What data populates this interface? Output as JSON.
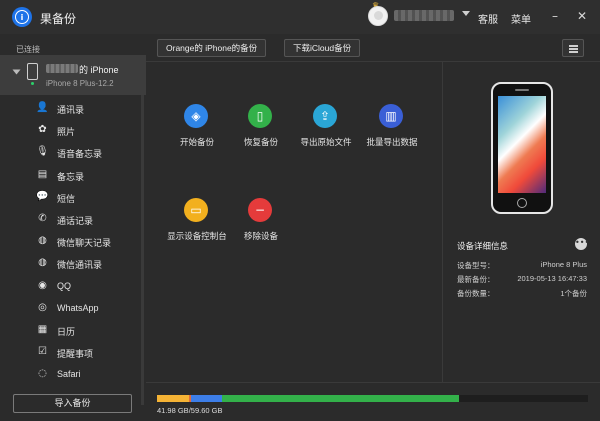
{
  "app": {
    "title": "果备份"
  },
  "header": {
    "support_label": "客服",
    "menu_label": "菜单"
  },
  "sidebar": {
    "connected_label": "已连接",
    "device": {
      "name_suffix": "的 iPhone",
      "model": "iPhone 8 Plus-12.2"
    },
    "items": [
      {
        "label": "通讯录",
        "icon": "contacts-icon",
        "glyph": "👤"
      },
      {
        "label": "照片",
        "icon": "photos-icon",
        "glyph": "✿"
      },
      {
        "label": "语音备忘录",
        "icon": "microphone-icon",
        "glyph": "🎙"
      },
      {
        "label": "备忘录",
        "icon": "notes-icon",
        "glyph": "▤"
      },
      {
        "label": "短信",
        "icon": "messages-icon",
        "glyph": "💬"
      },
      {
        "label": "通话记录",
        "icon": "call-log-icon",
        "glyph": "✆"
      },
      {
        "label": "微信聊天记录",
        "icon": "wechat-chat-icon",
        "glyph": "◍"
      },
      {
        "label": "微信通讯录",
        "icon": "wechat-contacts-icon",
        "glyph": "◍"
      },
      {
        "label": "QQ",
        "icon": "qq-icon",
        "glyph": "◉"
      },
      {
        "label": "WhatsApp",
        "icon": "whatsapp-icon",
        "glyph": "◎"
      },
      {
        "label": "日历",
        "icon": "calendar-icon",
        "glyph": "▦"
      },
      {
        "label": "提醒事项",
        "icon": "reminders-icon",
        "glyph": "☑"
      },
      {
        "label": "Safari",
        "icon": "safari-icon",
        "glyph": "◌"
      }
    ],
    "import_label": "导入备份"
  },
  "tabs": [
    {
      "label": "Orange的 iPhone的备份"
    },
    {
      "label": "下载iCloud备份"
    }
  ],
  "actions": [
    {
      "label": "开始备份",
      "icon": "layers-icon",
      "glyph": "◈",
      "color": "#2f86e8"
    },
    {
      "label": "恢复备份",
      "icon": "phone-restore-icon",
      "glyph": "▯",
      "color": "#33b14a"
    },
    {
      "label": "导出原始文件",
      "icon": "export-icon",
      "glyph": "⇪",
      "color": "#2aa6d6"
    },
    {
      "label": "批量导出数据",
      "icon": "batch-export-icon",
      "glyph": "▥",
      "color": "#3a5fd6"
    },
    {
      "label": "显示设备控制台",
      "icon": "console-icon",
      "glyph": "▭",
      "color": "#f2b01e"
    },
    {
      "label": "移除设备",
      "icon": "remove-icon",
      "glyph": "−",
      "color": "#e53b3b"
    }
  ],
  "details": {
    "title": "设备详细信息",
    "rows": [
      {
        "key": "设备型号：",
        "value": "iPhone 8 Plus"
      },
      {
        "key": "最新备份：",
        "value": "2019-05-13 16:47:33"
      },
      {
        "key": "备份数量：",
        "value": "1个备份"
      }
    ]
  },
  "storage": {
    "text": "41.98 GB/59.60 GB",
    "used_gb": 41.98,
    "total_gb": 59.6,
    "segments": [
      {
        "color": "#f5b335",
        "fraction": 0.075
      },
      {
        "color": "#e06b3a",
        "fraction": 0.005
      },
      {
        "color": "#3d7ee8",
        "fraction": 0.07
      },
      {
        "color": "#33b14a",
        "fraction": 0.55
      }
    ]
  }
}
